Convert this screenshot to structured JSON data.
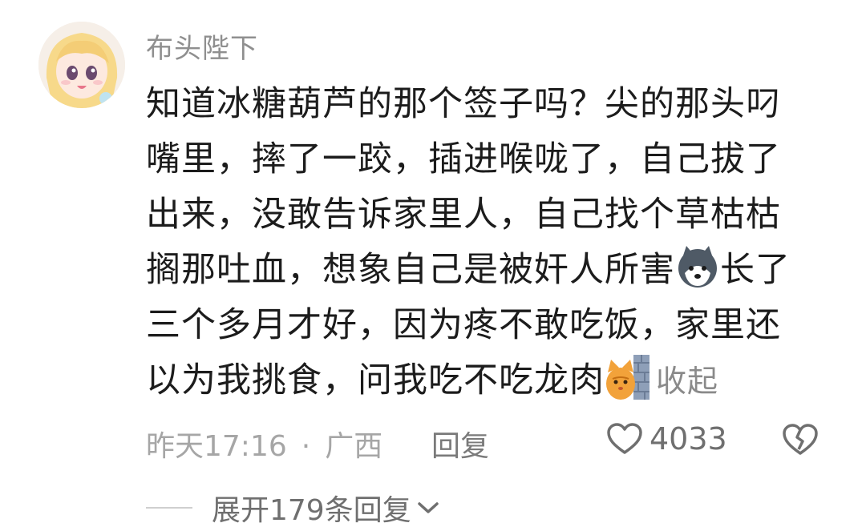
{
  "comment": {
    "username": "布头陛下",
    "lines": [
      "知道冰糖葫芦的那个签子吗？尖的那头叼",
      "嘴里，摔了一跤，插进喉咙了，自己拔了",
      "出来，没敢告诉家里人，自己找个草枯枯",
      "搁那吐血，想象自己是被奸人所害",
      "长了",
      "三个多月才好，因为疼不敢吃饭，家里还",
      "以为我挑食，问我吃不吃龙肉"
    ],
    "collapse_label": "收起",
    "time": "昨天17:16",
    "separator": "·",
    "location": "广西",
    "reply_label": "回复",
    "like_count": "4033",
    "icons": {
      "like": "heart-icon",
      "dislike": "broken-heart-icon",
      "emoji1": "husky-emoji-icon",
      "emoji2": "cat-wall-emoji-icon"
    }
  },
  "replies": {
    "expand_label": "展开179条回复"
  }
}
